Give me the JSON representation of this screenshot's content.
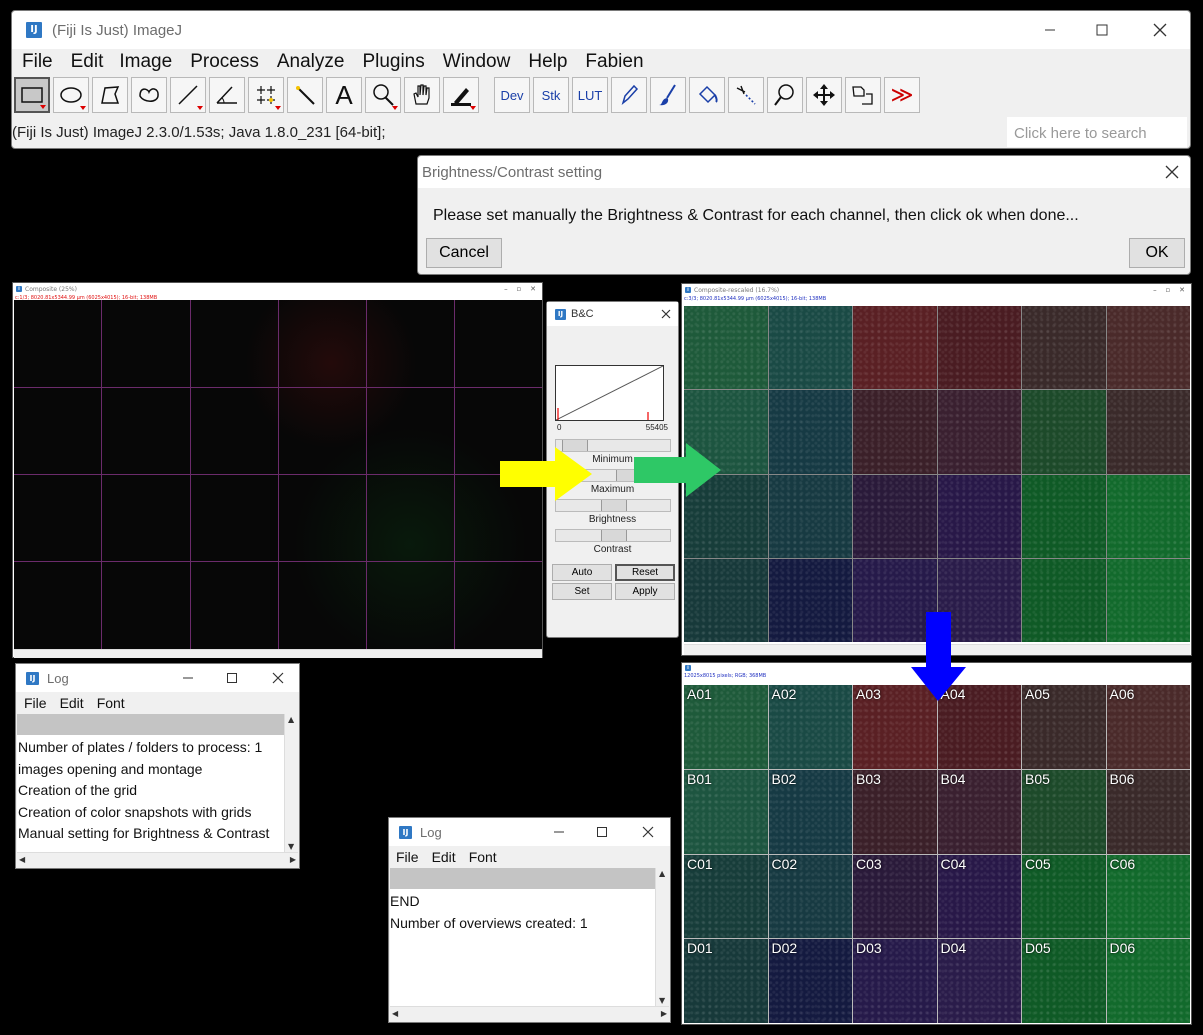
{
  "main_window": {
    "title": "(Fiji Is Just) ImageJ",
    "menus": [
      "File",
      "Edit",
      "Image",
      "Process",
      "Analyze",
      "Plugins",
      "Window",
      "Help",
      "Fabien"
    ],
    "tools": [
      {
        "icon": "rectangle-select-icon"
      },
      {
        "icon": "oval-select-icon"
      },
      {
        "icon": "polygon-select-icon"
      },
      {
        "icon": "freehand-select-icon"
      },
      {
        "icon": "line-tool-icon"
      },
      {
        "icon": "angle-tool-icon"
      },
      {
        "icon": "multipoint-tool-icon"
      },
      {
        "icon": "wand-tool-icon"
      },
      {
        "icon": "text-tool-icon",
        "glyph": "A"
      },
      {
        "icon": "magnifier-tool-icon"
      },
      {
        "icon": "hand-tool-icon"
      },
      {
        "icon": "color-picker-icon"
      },
      {
        "icon": "dev-menu-icon",
        "glyph": "Dev"
      },
      {
        "icon": "stk-menu-icon",
        "glyph": "Stk"
      },
      {
        "icon": "lut-menu-icon",
        "glyph": "LUT"
      },
      {
        "icon": "pencil-tool-icon"
      },
      {
        "icon": "brush-tool-icon"
      },
      {
        "icon": "flood-fill-icon"
      },
      {
        "icon": "arrow-tool-icon"
      },
      {
        "icon": "zoom-tool-icon"
      },
      {
        "icon": "move-tool-icon"
      },
      {
        "icon": "macro-tool-icon"
      },
      {
        "icon": "more-tools-icon",
        "glyph": "≫"
      }
    ],
    "status": "(Fiji Is Just) ImageJ 2.3.0/1.53s; Java 1.8.0_231 [64-bit];",
    "search_placeholder": "Click here to search"
  },
  "dialog": {
    "title": "Brightness/Contrast setting",
    "message": "Please set manually the Brightness & Contrast for each channel, then click ok when done...",
    "cancel": "Cancel",
    "ok": "OK"
  },
  "composite_window": {
    "title": "Composite (25%)",
    "info": "c:1/3; 8020.81x5344.99 μm (6025x4015); 16-bit; 138MB"
  },
  "bc_window": {
    "title": "B&C",
    "hist_min": "0",
    "hist_max": "55405",
    "labels": [
      "Minimum",
      "Maximum",
      "Brightness",
      "Contrast"
    ],
    "buttons": {
      "auto": "Auto",
      "reset": "Reset",
      "set": "Set",
      "apply": "Apply"
    }
  },
  "rescaled_window": {
    "title": "Composite-rescaled (16.7%)",
    "info": "c:3/3; 8020.81x5344.99 μm (6025x4015); 16-bit; 138MB"
  },
  "montage_window": {
    "info": "12025x8015 pixels; RGB; 368MB",
    "rows": [
      [
        "A01",
        "A02",
        "A03",
        "A04",
        "A05",
        "A06"
      ],
      [
        "B01",
        "B02",
        "B03",
        "B04",
        "B05",
        "B06"
      ],
      [
        "C01",
        "C02",
        "C03",
        "C04",
        "C05",
        "C06"
      ],
      [
        "D01",
        "D02",
        "D03",
        "D04",
        "D05",
        "D06"
      ]
    ]
  },
  "log1": {
    "title": "Log",
    "menus": [
      "File",
      "Edit",
      "Font"
    ],
    "lines": [
      "Number of plates / folders to process: 1",
      "images opening and montage",
      "Creation of the grid",
      "Creation of color snapshots with grids",
      "Manual setting for Brightness & Contrast"
    ]
  },
  "log2": {
    "title": "Log",
    "menus": [
      "File",
      "Edit",
      "Font"
    ],
    "lines": [
      "END",
      "Number of overviews created: 1"
    ]
  },
  "colors": {
    "arrow_yellow": "#ffff00",
    "arrow_green": "#2ec866",
    "arrow_blue": "#0000ff",
    "fiji_blue": "#2f78c4"
  }
}
